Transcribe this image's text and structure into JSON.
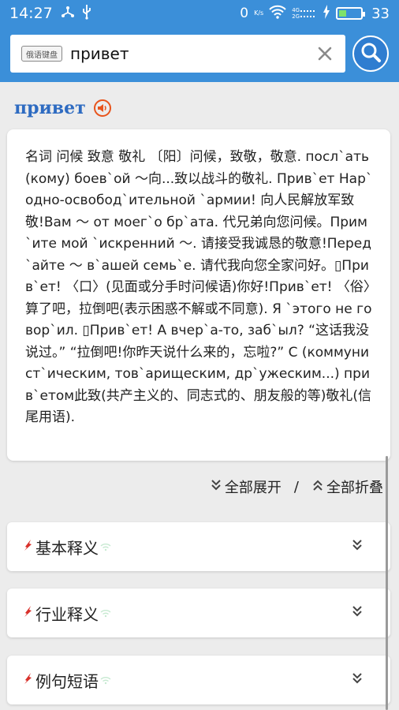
{
  "status_bar": {
    "time": "14:27",
    "netspeed_value": "0",
    "netspeed_unit": "K/s",
    "signal_label_top": "4G",
    "signal_label_bottom": "2G",
    "battery_percent": "33",
    "battery_level": 0.33
  },
  "search": {
    "keyboard_badge": "俄语键盘",
    "query": "привет"
  },
  "entry": {
    "word": "привет",
    "definition": "名词 问候 致意 敬礼 〔阳〕问候，致敬，敬意. посл`ать (кому) боев`ой 〜向...致以战斗的敬礼. Прив`ет Нар`одно-освобод`ительной `армии! 向人民解放军致敬!Вам 〜 от моег`о бр`ата. 代兄弟向您问候。Прим`ите мой `искренний 〜. 请接受我诚恳的敬意!Перед`айте 〜 в`ашей семь`е. 请代我向您全家问好。▯Прив`ет! 〈口〉(见面或分手时问候语)你好!Прив`ет! 〈俗〉算了吧，拉倒吧(表示困惑不解或不同意). Я `этого не говор`ил. ▯Прив`ет! А вчер`а-то, заб`ыл? “这话我没说过。” “拉倒吧!你昨天说什么来的，忘啦?” С (коммунист`ическим, тов`арищеским, др`ужеским...) прив`етом此致(共产主义的、同志式的、朋友般的等)敬礼(信尾用语)."
  },
  "controls": {
    "expand_all": "全部展开",
    "separator": "/",
    "collapse_all": "全部折叠"
  },
  "sections": [
    {
      "label": "基本释义"
    },
    {
      "label": "行业释义"
    },
    {
      "label": "例句短语"
    }
  ],
  "colors": {
    "header_blue": "#3b8fd9",
    "title_blue": "#2e6bc1",
    "accent_orange": "#e8541c",
    "background": "#ececec"
  }
}
